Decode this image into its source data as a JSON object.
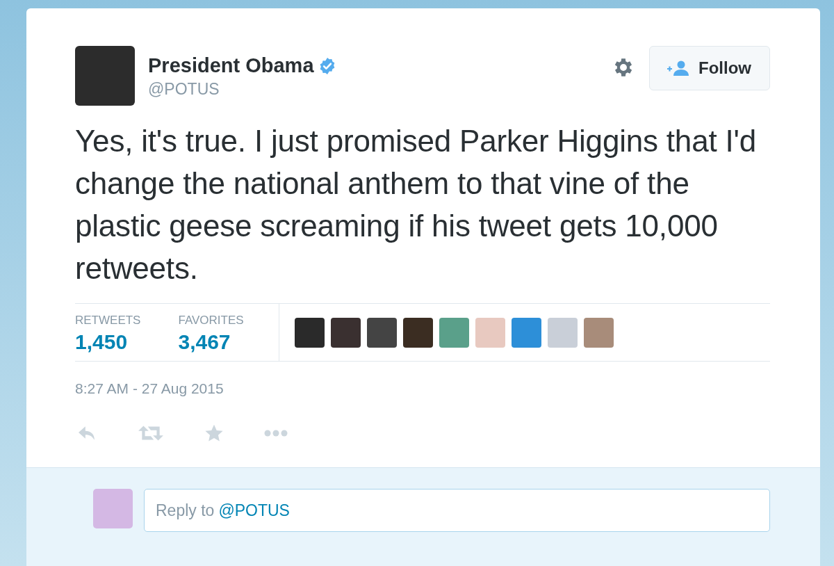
{
  "author": {
    "name": "President Obama",
    "handle": "@POTUS",
    "verified": true
  },
  "follow_button": {
    "label": "Follow"
  },
  "tweet": {
    "text": "Yes, it's true. I just promised Parker Higgins that I'd change the national anthem to that vine of the plastic geese screaming if his tweet gets 10,000 retweets."
  },
  "stats": [
    {
      "label": "RETWEETS",
      "count": "1,450"
    },
    {
      "label": "FAVORITES",
      "count": "3,467"
    }
  ],
  "timestamp": "8:27 AM - 27 Aug 2015",
  "reply": {
    "placeholder": "Reply to",
    "mention": "@POTUS"
  }
}
